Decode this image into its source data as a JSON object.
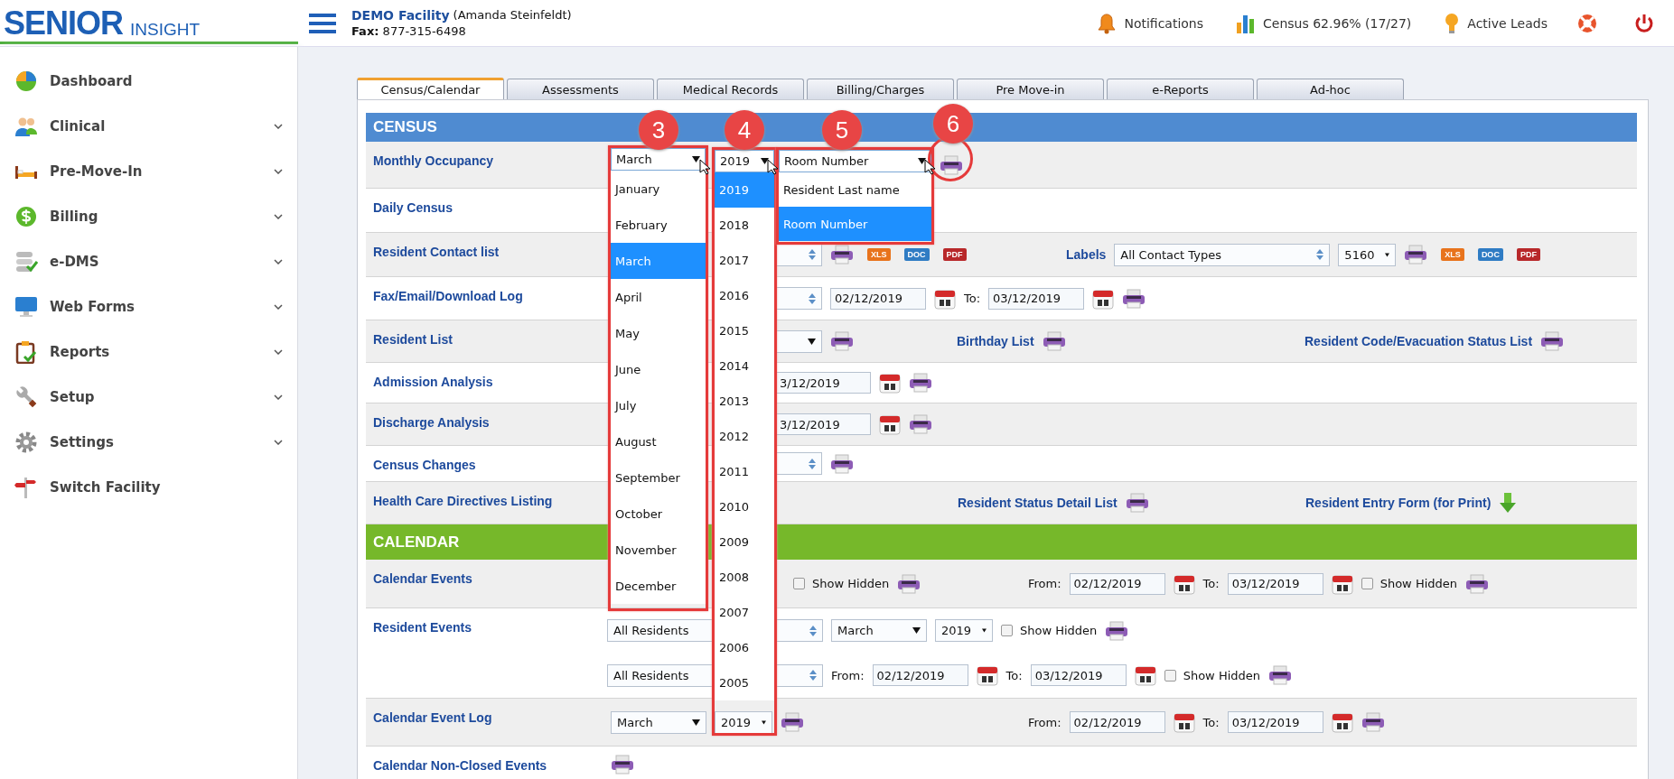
{
  "logo": {
    "word": "SENIOR",
    "sub": "INSIGHT"
  },
  "facility": {
    "name": "DEMO Facility",
    "user": "(Amanda Steinfeldt)",
    "fax": "**Fax:** 877-315-6498"
  },
  "header_links": [
    {
      "kind": "notifications",
      "label": "Notifications"
    },
    {
      "kind": "census",
      "label": "Census 62.96% (17/27)"
    },
    {
      "kind": "leads",
      "label": "Active Leads"
    },
    {
      "kind": "help"
    },
    {
      "kind": "power"
    }
  ],
  "sidebar": [
    {
      "kind": "dashboard",
      "label": "Dashboard",
      "has_submenu": false
    },
    {
      "kind": "clinical",
      "label": "Clinical",
      "has_submenu": true
    },
    {
      "kind": "premove",
      "label": "Pre-Move-In",
      "has_submenu": true
    },
    {
      "kind": "billing",
      "label": "Billing",
      "has_submenu": true
    },
    {
      "kind": "edms",
      "label": "e-DMS",
      "has_submenu": true
    },
    {
      "kind": "webforms",
      "label": "Web Forms",
      "has_submenu": true
    },
    {
      "kind": "reports",
      "label": "Reports",
      "has_submenu": true
    },
    {
      "kind": "setup",
      "label": "Setup",
      "has_submenu": true
    },
    {
      "kind": "settings",
      "label": "Settings",
      "has_submenu": true
    },
    {
      "kind": "switch",
      "label": "Switch Facility",
      "has_submenu": false
    }
  ],
  "tabs": [
    {
      "label": "Census/Calendar",
      "selected": true
    },
    {
      "label": "Assessments",
      "selected": false
    },
    {
      "label": "Medical Records",
      "selected": false
    },
    {
      "label": "Billing/Charges",
      "selected": false
    },
    {
      "label": "Pre Move-in",
      "selected": false
    },
    {
      "label": "e-Reports",
      "selected": false
    },
    {
      "label": "Ad-hoc",
      "selected": false
    }
  ],
  "sections": [
    {
      "kind": "census",
      "title": "CENSUS",
      "rows": [
        {
          "label": "Monthly Occupancy",
          "lines": [
            [
              [
                {
                  "kind": "print"
                }
              ]
            ]
          ]
        },
        {
          "label": "Daily Census"
        },
        {
          "label": "Resident Contact list",
          "lines": [
            [
              [
                {
                  "kind": "spin-select"
                },
                {
                  "kind": "print"
                },
                {
                  "kind": "file",
                  "label": "XLS",
                  "color": "#e8731c"
                },
                {
                  "kind": "file",
                  "label": "DOC",
                  "color": "#2f7cc4"
                },
                {
                  "kind": "file",
                  "label": "PDF",
                  "color": "#b8282a"
                }
              ],
              [
                {
                  "kind": "link",
                  "text": "Labels"
                },
                {
                  "kind": "spin-select",
                  "value": "All Contact Types"
                },
                {
                  "kind": "select",
                  "value": "5160"
                },
                {
                  "kind": "print"
                },
                {
                  "kind": "file",
                  "label": "XLS",
                  "color": "#e8731c"
                },
                {
                  "kind": "file",
                  "label": "DOC",
                  "color": "#2f7cc4"
                },
                {
                  "kind": "file",
                  "label": "PDF",
                  "color": "#b8282a"
                }
              ]
            ]
          ]
        },
        {
          "label": "Fax/Email/Download Log",
          "lines": [
            [
              [
                {
                  "kind": "spin-select"
                },
                {
                  "kind": "date",
                  "value": "02/12/2019"
                },
                {
                  "kind": "calendar"
                },
                {
                  "kind": "text",
                  "text": "To:"
                },
                {
                  "kind": "date",
                  "value": "03/12/2019"
                },
                {
                  "kind": "calendar"
                },
                {
                  "kind": "print"
                }
              ]
            ]
          ]
        },
        {
          "label": "Resident List",
          "lines": [
            [
              [
                {
                  "kind": "select"
                },
                {
                  "kind": "print"
                }
              ],
              [
                {
                  "kind": "link",
                  "text": "Birthday List"
                },
                {
                  "kind": "print"
                }
              ],
              [
                {
                  "kind": "link",
                  "text": "Resident Code/Evacuation Status List"
                },
                {
                  "kind": "print"
                }
              ]
            ]
          ]
        },
        {
          "label": "Admission Analysis",
          "lines": [
            [
              [
                {
                  "kind": "date",
                  "value": "3/12/2019"
                },
                {
                  "kind": "calendar"
                },
                {
                  "kind": "print"
                }
              ]
            ]
          ]
        },
        {
          "label": "Discharge Analysis",
          "lines": [
            [
              [
                {
                  "kind": "date",
                  "value": "3/12/2019"
                },
                {
                  "kind": "calendar"
                },
                {
                  "kind": "print"
                }
              ]
            ]
          ]
        },
        {
          "label": "Census Changes",
          "lines": [
            [
              [
                {
                  "kind": "spin-select"
                },
                {
                  "kind": "print"
                }
              ]
            ]
          ]
        },
        {
          "label": "Health Care Directives Listing",
          "lines": [
            [
              [
                {
                  "kind": "link",
                  "text": "Resident Status Detail List"
                },
                {
                  "kind": "print"
                }
              ],
              [
                {
                  "kind": "link",
                  "text": "Resident Entry Form (for Print)"
                },
                {
                  "kind": "download"
                }
              ]
            ]
          ]
        }
      ]
    },
    {
      "kind": "calendar",
      "title": "CALENDAR",
      "rows": [
        {
          "label": "Calendar Events",
          "lines": [
            [
              [
                {
                  "kind": "checkbox",
                  "label": "Show Hidden",
                  "checked": false
                },
                {
                  "kind": "print"
                }
              ],
              [
                {
                  "kind": "text",
                  "text": "From:"
                },
                {
                  "kind": "date",
                  "value": "02/12/2019"
                },
                {
                  "kind": "calendar"
                },
                {
                  "kind": "text",
                  "text": "To:"
                },
                {
                  "kind": "date",
                  "value": "03/12/2019"
                },
                {
                  "kind": "calendar"
                },
                {
                  "kind": "checkbox",
                  "label": "Show Hidden",
                  "checked": false
                },
                {
                  "kind": "print"
                }
              ]
            ]
          ]
        },
        {
          "label": "Resident Events",
          "lines": [
            [
              [
                {
                  "kind": "spin-select",
                  "value": "All Residents"
                },
                {
                  "kind": "select",
                  "value": "March"
                },
                {
                  "kind": "select",
                  "value": "2019"
                },
                {
                  "kind": "checkbox",
                  "label": "Show Hidden",
                  "checked": false
                },
                {
                  "kind": "print"
                }
              ]
            ],
            [
              [
                {
                  "kind": "spin-select",
                  "value": "All Residents"
                },
                {
                  "kind": "text",
                  "text": "From:"
                },
                {
                  "kind": "date",
                  "value": "02/12/2019"
                },
                {
                  "kind": "calendar"
                },
                {
                  "kind": "text",
                  "text": "To:"
                },
                {
                  "kind": "date",
                  "value": "03/12/2019"
                },
                {
                  "kind": "calendar"
                },
                {
                  "kind": "checkbox",
                  "label": "Show Hidden",
                  "checked": false
                },
                {
                  "kind": "print"
                }
              ]
            ]
          ]
        },
        {
          "label": "Calendar Event Log",
          "lines": [
            [
              [
                {
                  "kind": "select",
                  "value": "March"
                },
                {
                  "kind": "select",
                  "value": "2019"
                },
                {
                  "kind": "print"
                }
              ],
              [
                {
                  "kind": "text",
                  "text": "From:"
                },
                {
                  "kind": "date",
                  "value": "02/12/2019"
                },
                {
                  "kind": "calendar"
                },
                {
                  "kind": "text",
                  "text": "To:"
                },
                {
                  "kind": "date",
                  "value": "03/12/2019"
                },
                {
                  "kind": "calendar"
                },
                {
                  "kind": "print"
                }
              ]
            ]
          ]
        },
        {
          "label": "Calendar Non-Closed Events",
          "lines": [
            [
              [
                {
                  "kind": "print"
                }
              ]
            ]
          ]
        }
      ]
    }
  ],
  "dropdowns": [
    {
      "callout": "3",
      "value": "March",
      "options": [
        {
          "label": "January",
          "selected": false
        },
        {
          "label": "February",
          "selected": false
        },
        {
          "label": "March",
          "selected": true
        },
        {
          "label": "April",
          "selected": false
        },
        {
          "label": "May",
          "selected": false
        },
        {
          "label": "June",
          "selected": false
        },
        {
          "label": "July",
          "selected": false
        },
        {
          "label": "August",
          "selected": false
        },
        {
          "label": "September",
          "selected": false
        },
        {
          "label": "October",
          "selected": false
        },
        {
          "label": "November",
          "selected": false
        },
        {
          "label": "December",
          "selected": false
        }
      ]
    },
    {
      "callout": "4",
      "value": "2019",
      "options": [
        {
          "label": "2019",
          "selected": true
        },
        {
          "label": "2018",
          "selected": false
        },
        {
          "label": "2017",
          "selected": false
        },
        {
          "label": "2016",
          "selected": false
        },
        {
          "label": "2015",
          "selected": false
        },
        {
          "label": "2014",
          "selected": false
        },
        {
          "label": "2013",
          "selected": false
        },
        {
          "label": "2012",
          "selected": false
        },
        {
          "label": "2011",
          "selected": false
        },
        {
          "label": "2010",
          "selected": false
        },
        {
          "label": "2009",
          "selected": false
        },
        {
          "label": "2008",
          "selected": false
        },
        {
          "label": "2007",
          "selected": false
        },
        {
          "label": "2006",
          "selected": false
        },
        {
          "label": "2005",
          "selected": false
        }
      ]
    },
    {
      "callout": "5",
      "value": "Room Number",
      "options": [
        {
          "label": "Resident Last name",
          "selected": false
        },
        {
          "label": "Room Number",
          "selected": true
        }
      ]
    }
  ],
  "print_callout": "6"
}
